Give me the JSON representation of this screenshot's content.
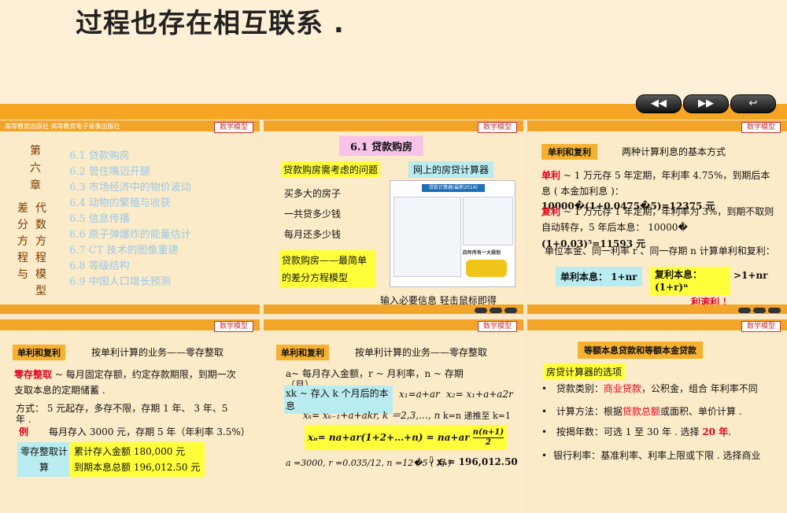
{
  "top": {
    "title": "过程也存在相互联系 .",
    "nav": [
      "◀◀",
      "▶▶",
      "↩"
    ]
  },
  "tag": "数学模型",
  "slide1": {
    "publisher": "高等教育出版社 高等教育电子音像出版社",
    "chapter_chars": [
      "第",
      "六",
      "章"
    ],
    "vertical_cols": [
      [
        "差",
        "分",
        "方",
        "程",
        "与"
      ],
      [
        "代",
        "数",
        "方",
        "程",
        "模",
        "型"
      ]
    ],
    "toc": [
      "6.1  贷款购房",
      "6.2  管住嘴迈开腿",
      "6.3  市场经济中的物价波动",
      "6.4  动物的繁殖与收获",
      "6.5  信息传播",
      "6.6  原子弹爆炸的能量估计",
      "6.7  CT 技术的图像重建",
      "6.8  等级结构",
      "6.9  中国人口增长预测"
    ]
  },
  "slide2": {
    "title": "6.1   贷款购房",
    "q_label": "贷款购房需考虑的问题",
    "calc_label": "网上的房贷计算器",
    "items": [
      "买多大的房子",
      "一共贷多少钱",
      "每月还多少钱"
    ],
    "model": "贷款购房——最简单的差分方程模型",
    "hint": "输入必要信息   轻击鼠标即得",
    "calc_title": "贷款计算器(最新2014)",
    "calc_result": "四年所有一大规划"
  },
  "slide3": {
    "heading": "单利和复利",
    "subtitle": "两种计算利息的基本方式",
    "simple_label": "单利",
    "simple_text": " ~ 1 万元存 5 年定期，年利率 4.75%，到期后本息 ( 本金加利息 )：",
    "simple_calc": "10000�(1+0.0475�5)=12375 元",
    "compound_label": "复利",
    "compound_text": " ~ 1 万元存 1 年定期，年利率为 3%，到期不取则自动转存，5 年后本息：  10000�",
    "compound_calc": "(1+0.03)⁵=11593 元",
    "note": "单位本金、同一利率 r 、同一存期 n 计算单利和复利：",
    "simple_formula": "单利本息：  1+nr",
    "compound_formula": "复利本息：",
    "compound_formula2": "(1+r)ⁿ",
    "gt": ">1+nr",
    "red_note": "利滚利 !"
  },
  "slide4": {
    "heading": "单利和复利",
    "subtitle": "按单利计算的业务——零存整取",
    "term": "零存整取",
    "def": " ~ 每月固定存额，约定存款期限，到期一次支取本息的定期储蓄 .",
    "method": "方式：  5 元起存，多存不限，存期 1 年、 3 年、5 年 .",
    "example_label": "例",
    "example": "每月存入 3000 元，存期 5 年（年利率 3.5%）",
    "calc_label": "零存整取计算",
    "result1": "累计存入金额 180,000 元",
    "result2": "到期本息总额 196,012.50 元"
  },
  "slide5": {
    "heading": "单利和复利",
    "subtitle": "按单利计算的业务——零存整取",
    "vars": "a~ 每月存入金额，r ~ 月利率，n ~ 存期（月）",
    "xk_def": "xk ~ 存入 k 个月后的本息",
    "x1": "x₁=a+ar",
    "x2": "x₂= x₁+a+a2r",
    "recur": "xₖ= xₖ₋₁+a+akr,  k ＝2,3,…, n",
    "recur_note": "k=n 递推至 k=1",
    "sum": "xₙ= na+ar(1+2+…+n)  = na+ar",
    "frac_num": "n(n+1)",
    "frac_den": "2",
    "params": "a =3000, r =0.035/12,  n =12�5 ( 月 )",
    "result": "xₙ= 196,012.50"
  },
  "slide6": {
    "heading": "等额本息贷款和等额本金贷款",
    "sub": "房贷计算器的选项",
    "b1_pre": "贷款类别：",
    "b1_red": "商业贷款",
    "b1_post": "，公积金，组合      年利率不同",
    "b2_pre": "计算方法：根据",
    "b2_red": "贷款总额",
    "b2_post": "或面积、单价计算 .",
    "b3_pre": "按揭年数：可选 1 至 30 年 .  选择 ",
    "b3_red": "20 年",
    "b3_post": ".",
    "b4": "银行利率：基准利率、利率上限或下限 .  选择商业"
  }
}
